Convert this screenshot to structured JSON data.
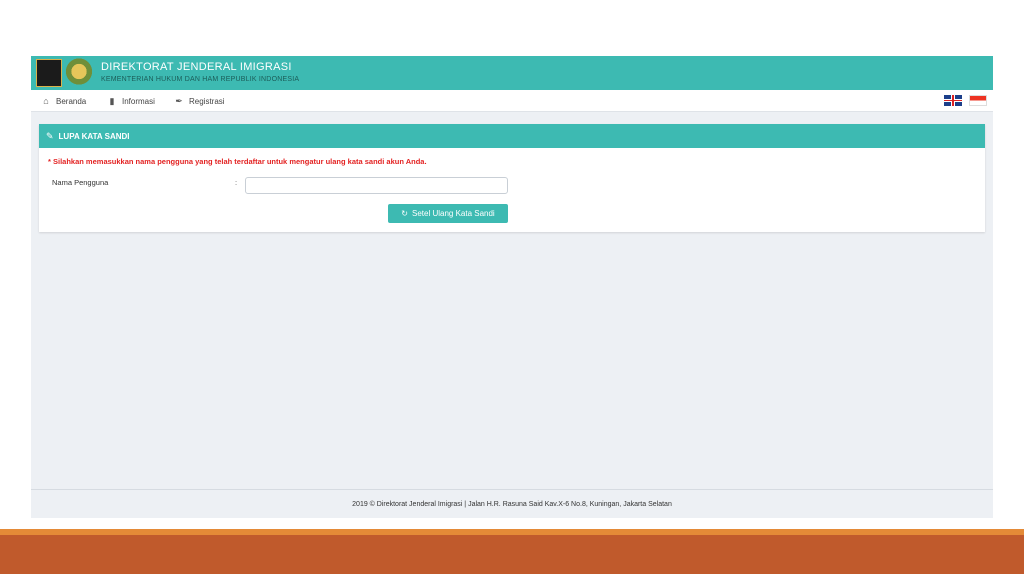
{
  "header": {
    "title": "DIREKTORAT JENDERAL IMIGRASI",
    "subtitle": "KEMENTERIAN HUKUM DAN HAM REPUBLIK INDONESIA"
  },
  "nav": {
    "items": [
      {
        "label": "Beranda",
        "icon": "home-icon"
      },
      {
        "label": "Informasi",
        "icon": "book-icon"
      },
      {
        "label": "Registrasi",
        "icon": "brush-icon"
      }
    ],
    "languages": [
      "english-flag-icon",
      "indonesia-flag-icon"
    ]
  },
  "panel": {
    "title": "LUPA KATA SANDI",
    "notice": "* Silahkan memasukkan nama pengguna yang telah terdaftar untuk mengatur ulang kata sandi akun Anda.",
    "field_label": "Nama Pengguna",
    "colon": ":",
    "field_value": "",
    "button_label": "Setel Ulang Kata Sandi"
  },
  "footer": {
    "text": "2019 © Direktorat Jenderal Imigrasi | Jalan H.R. Rasuna Said Kav.X-6 No.8, Kuningan, Jakarta Selatan"
  },
  "colors": {
    "brand": "#3dbab2",
    "alert": "#e32222",
    "slide_accent": "#e48a37",
    "slide_bar": "#c05a2c"
  }
}
